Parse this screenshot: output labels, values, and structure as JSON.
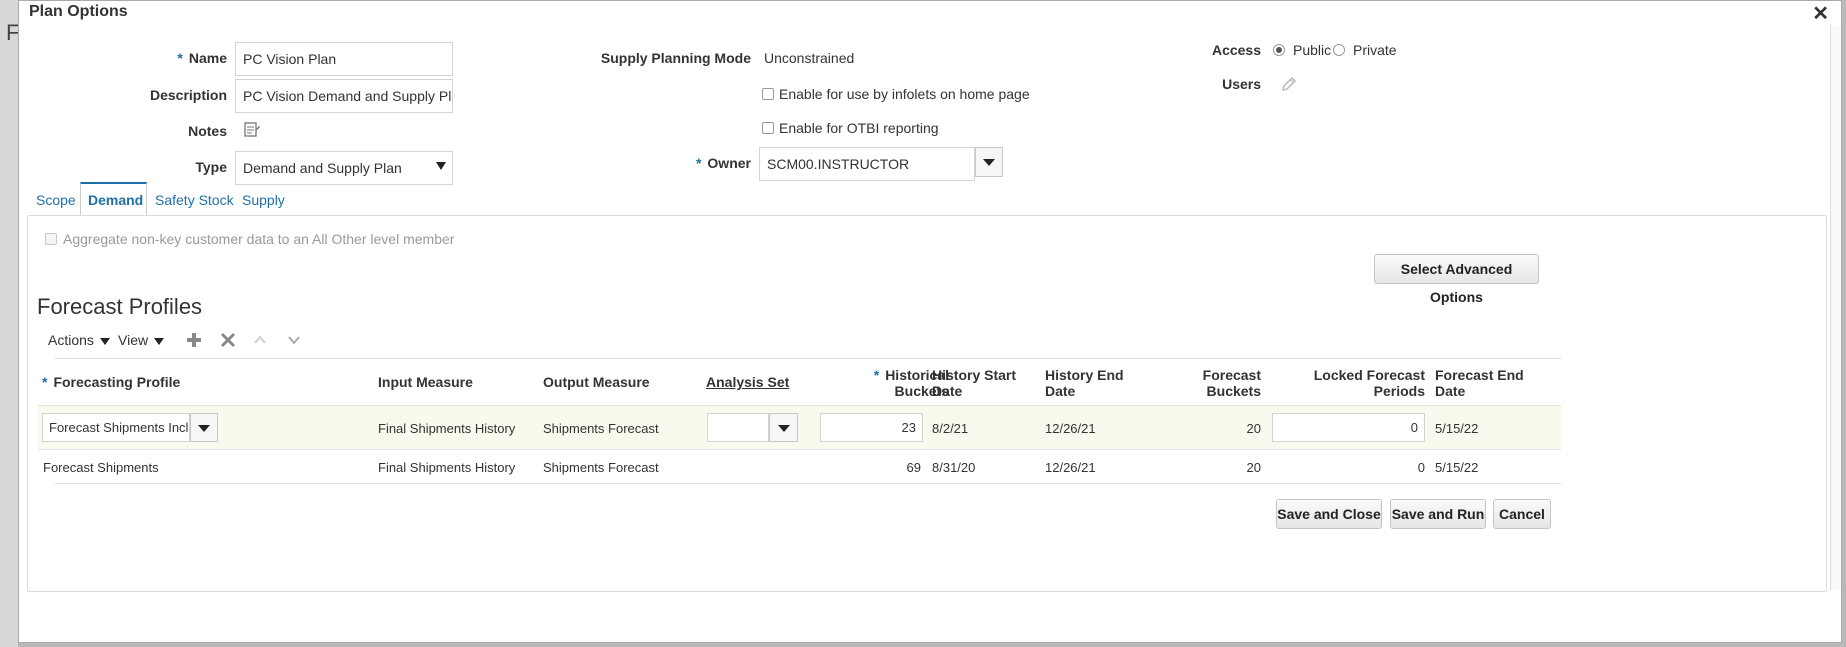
{
  "background": {
    "letter": "F"
  },
  "dialog": {
    "title": "Plan Options",
    "close_glyph": "✕"
  },
  "form": {
    "name_label": "Name",
    "name_value": "PC Vision Plan",
    "description_label": "Description",
    "description_value": "PC Vision Demand and Supply Plan",
    "notes_label": "Notes",
    "type_label": "Type",
    "type_value": "Demand and Supply Plan",
    "supply_mode_label": "Supply Planning Mode",
    "supply_mode_value": "Unconstrained",
    "infolets_label": "Enable for use by infolets on home page",
    "otbi_label": "Enable for OTBI reporting",
    "owner_label": "Owner",
    "owner_value": "SCM00.INSTRUCTOR",
    "access_label": "Access",
    "access_public": "Public",
    "access_private": "Private",
    "users_label": "Users",
    "required_mark": "*"
  },
  "tabs": [
    {
      "label": "Scope"
    },
    {
      "label": "Demand"
    },
    {
      "label": "Safety Stock"
    },
    {
      "label": "Supply"
    }
  ],
  "demand": {
    "aggregate_label": "Aggregate non-key customer data to an All Other level member",
    "advanced_button": "Select Advanced Options",
    "section_title": "Forecast Profiles",
    "toolbar": {
      "actions": "Actions",
      "view": "View"
    }
  },
  "table": {
    "headers": {
      "profile": "Forecasting Profile",
      "input": "Input Measure",
      "output": "Output Measure",
      "analysis": "Analysis Set",
      "hist_buckets_1": "Historical",
      "hist_buckets_2": "Buckets",
      "hist_start_1": "History Start",
      "hist_start_2": "Date",
      "hist_end_1": "History End",
      "hist_end_2": "Date",
      "fc_buckets_1": "Forecast",
      "fc_buckets_2": "Buckets",
      "locked_1": "Locked Forecast",
      "locked_2": "Periods",
      "fc_end_1": "Forecast End",
      "fc_end_2": "Date"
    },
    "rows": [
      {
        "profile": "Forecast Shipments Includ",
        "input": "Final Shipments History",
        "output": "Shipments Forecast",
        "analysis": "",
        "hist_buckets": "23",
        "hist_start": "8/2/21",
        "hist_end": "12/26/21",
        "fc_buckets": "20",
        "locked": "0",
        "fc_end": "5/15/22"
      },
      {
        "profile": "Forecast Shipments",
        "input": "Final Shipments History",
        "output": "Shipments Forecast",
        "analysis": "",
        "hist_buckets": "69",
        "hist_start": "8/31/20",
        "hist_end": "12/26/21",
        "fc_buckets": "20",
        "locked": "0",
        "fc_end": "5/15/22"
      }
    ]
  },
  "footer": {
    "save_close": "Save and Close",
    "save_run": "Save and Run",
    "cancel": "Cancel"
  },
  "colors": {
    "accent": "#1f6fa8",
    "row_highlight": "#f7faec"
  }
}
